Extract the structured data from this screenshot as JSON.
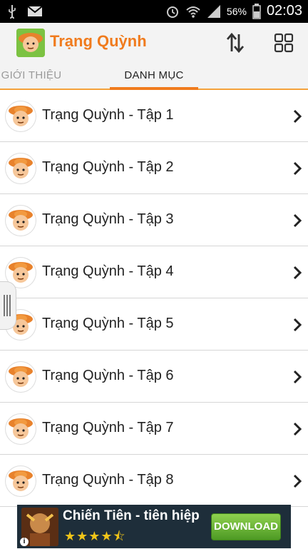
{
  "status_bar": {
    "battery": "56%",
    "time": "02:03",
    "icons": [
      "usb-icon",
      "gmail-icon",
      "alarm-icon",
      "wifi-icon",
      "signal-icon",
      "battery-icon"
    ]
  },
  "action_bar": {
    "title": "Trạng Quỳnh",
    "icons": [
      "sort-icon",
      "grid-icon"
    ],
    "accent": "#f07b1d"
  },
  "tabs": [
    {
      "label": "GIỚI THIỆU",
      "active": false
    },
    {
      "label": "DANH MỤC",
      "active": true
    }
  ],
  "list": [
    {
      "label": "Trạng Quỳnh - Tập 1"
    },
    {
      "label": "Trạng Quỳnh - Tập 2"
    },
    {
      "label": "Trạng Quỳnh - Tập 3"
    },
    {
      "label": "Trạng Quỳnh - Tập 4"
    },
    {
      "label": "Trạng Quỳnh - Tập 5"
    },
    {
      "label": "Trạng Quỳnh - Tập 6"
    },
    {
      "label": "Trạng Quỳnh - Tập 7"
    },
    {
      "label": "Trạng Quỳnh - Tập 8"
    }
  ],
  "ad": {
    "title": "Chiến Tiên - tiên hiệp",
    "rating": 4.5,
    "stars": "★★★★⯪",
    "button": "DOWNLOAD",
    "info": "i"
  }
}
